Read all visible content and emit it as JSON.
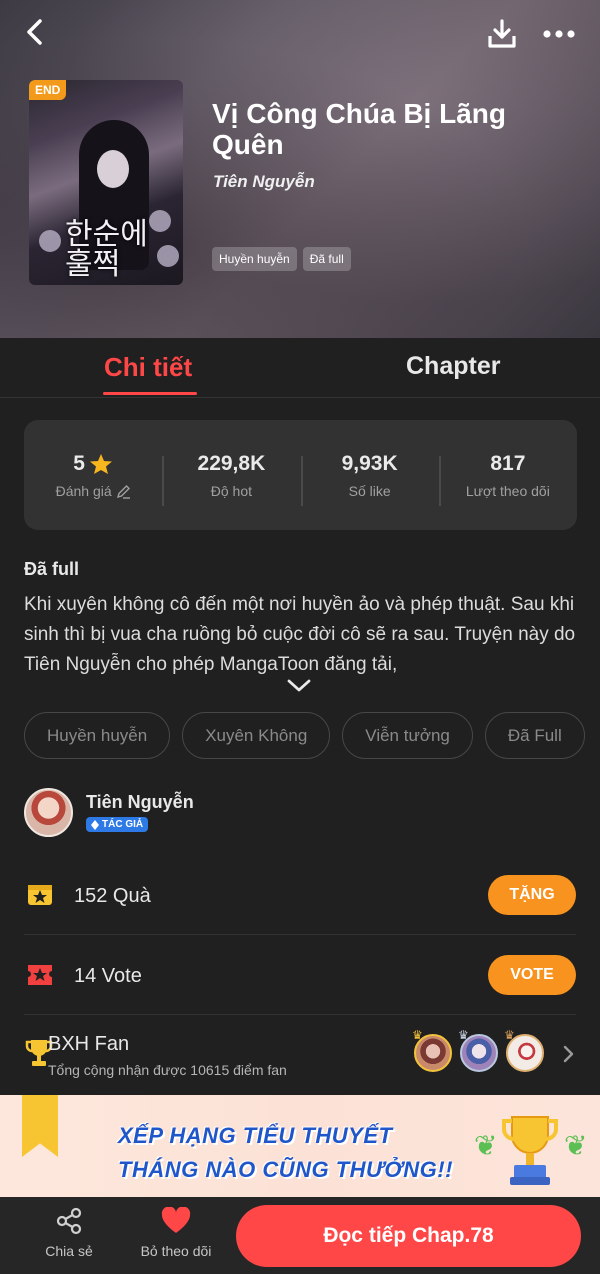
{
  "header": {
    "title": "Vị Công Chúa Bị Lãng Quên",
    "author": "Tiên Nguyễn",
    "end_badge": "END",
    "cover_text": "한순에 훌쩍",
    "tags": [
      "Huyền huyễn",
      "Đã full"
    ]
  },
  "tabs": [
    {
      "label": "Chi tiết",
      "active": true
    },
    {
      "label": "Chapter",
      "active": false
    }
  ],
  "stats": [
    {
      "value": "5",
      "label": "Đánh giá",
      "icon": "star-icon"
    },
    {
      "value": "229,8K",
      "label": "Độ hot"
    },
    {
      "value": "9,93K",
      "label": "Số like"
    },
    {
      "value": "817",
      "label": "Lượt theo dõi"
    }
  ],
  "description": {
    "status": "Đã full",
    "text": "Khi xuyên không cô đến một nơi huyền ảo và phép thuật. Sau khi sinh thì bị vua cha ruồng bỏ cuộc đời cô sẽ ra sau. Truyện này do Tiên Nguyễn cho phép MangaToon đăng tải,"
  },
  "categories": [
    "Huyền huyễn",
    "Xuyên Không",
    "Viễn tưởng",
    "Đã Full"
  ],
  "author": {
    "name": "Tiên Nguyễn",
    "badge": "TÁC GIẢ"
  },
  "gifts": {
    "text": "152 Quà",
    "button": "TẶNG"
  },
  "votes": {
    "text": "14 Vote",
    "button": "VOTE"
  },
  "fan_ranking": {
    "title": "BXH Fan",
    "subtitle": "Tổng cộng nhận được 10615 điểm fan"
  },
  "banner": {
    "line1": "XẾP HẠNG TIỂU THUYẾT",
    "line2": "THÁNG NÀO CŨNG THƯỞNG!!"
  },
  "bottom_bar": {
    "share": "Chia sẻ",
    "unfollow": "Bỏ theo dõi",
    "read": "Đọc tiếp Chap.78"
  },
  "colors": {
    "accent_red": "#ff4747",
    "accent_orange": "#f7931e",
    "background": "#202020"
  }
}
